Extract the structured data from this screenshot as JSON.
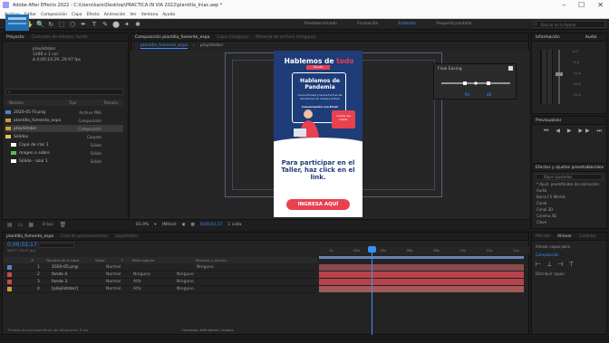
{
  "window": {
    "title": "Adobe After Effects 2022 - C:\\Users\\karo\\Desktop\\PRACTICA IN VIA 2022\\plantilla_Iniac.aep *",
    "controls": [
      "–",
      "☐",
      "✕"
    ]
  },
  "menu": [
    "Archivo",
    "Editar",
    "Composición",
    "Capa",
    "Efecto",
    "Animación",
    "Ver",
    "Ventana",
    "Ayuda"
  ],
  "toolbar": {
    "tools": [
      "⌂",
      "▶",
      "✋",
      "🔍",
      "↻",
      "⬚",
      "⬡",
      "✒",
      "T",
      "✎",
      "⬤",
      "✦",
      "✱"
    ],
    "workspaces": [
      "Predeterminado",
      "Formación",
      "Estándar",
      "Pequeña pantalla"
    ],
    "active_workspace": "Estándar",
    "search_placeholder": "Buscar en la Ayuda"
  },
  "project": {
    "tab": "Proyecto",
    "tab2": "Controles de efectos: fondo",
    "thumb_name": "playlistsbsr",
    "thumb_info1": "1280 x 1 col",
    "thumb_info2": "Δ 0;00;14;29, 29.97 fps",
    "headers": [
      "Nombre",
      "Tipo",
      "Tamaño",
      "Velocidad"
    ],
    "items": [
      {
        "name": "2020-05 Fil.png",
        "type": "Archivo PNG",
        "size": "147 KB",
        "color": "#4f83c4"
      },
      {
        "name": "plantilla_fomento_espa",
        "type": "Composición",
        "size": "",
        "color": "#c8a03a"
      },
      {
        "name": "playlistsbsr",
        "type": "Composición",
        "size": "",
        "color": "#c8a03a",
        "selected": true
      },
      {
        "name": "Sólidos",
        "type": "Carpeta",
        "size": "",
        "color": "#e3c35c"
      },
      {
        "name": "Capa de clar 1",
        "type": "Sólido",
        "size": "",
        "color": "#c64848"
      },
      {
        "name": "magen o sobre",
        "type": "Sólido",
        "size": "",
        "color": "#c64848"
      },
      {
        "name": "Sólido - azul 1",
        "type": "Sólido",
        "size": "",
        "color": "#c64848"
      }
    ],
    "bpc": "8 bpc"
  },
  "composition": {
    "tab": "Composición plantilla_fomento_espa",
    "tab2": "Capa (ninguno)",
    "tab3": "Material de archivo (ninguno)",
    "breadcrumb1": "plantilla_fomento_espa",
    "breadcrumb2": "playlistsbsr",
    "zoom": "81,9%",
    "resolution": "(Mitad)",
    "time": "0;00;02;17",
    "view": "1 vista"
  },
  "artwork": {
    "title_a": "Hablemos de",
    "title_b": "todo",
    "badge": "TALLER",
    "subtitle": "Hablemos de Pandemia",
    "desc": "Conocémosla y busca formas de blindarnos de manera activa",
    "tag": "Conversación con Ernst",
    "bubble": "Cuarta del hábito",
    "cta": "Para participar en el Taller, haz click en el link.",
    "button": "INGRESA AQUÍ"
  },
  "easy_panel": {
    "title": "Flow Easing",
    "v1": "93",
    "v2": "48"
  },
  "info": {
    "tab": "Información",
    "tab2": "Audio",
    "scale": [
      "0,0",
      "-6,0",
      "-12,0",
      "-18,0",
      "-24,0"
    ]
  },
  "preview": {
    "tab": "Previsualizar",
    "controls": "⏮ ◀ ▶ ▶▶ ⏭",
    "effects_tab": "Efectos y ajustes preestablecidos",
    "effects_search": "Bajos ajustados",
    "effects_items": [
      "* Ajust. predefinidos de animación",
      "Audio",
      "Barra FX Worlds",
      "Canal",
      "Canal 3D",
      "Cinema 4D",
      "Clave"
    ]
  },
  "timeline": {
    "tab": "plantilla_fomento_espa",
    "tab2": "Cola de procesamiento",
    "tab3": "playlistsbsr",
    "time": "0;00;02;17",
    "fps": "00077 (29,97 fps)",
    "headers": [
      "#",
      "Nombre de la capa",
      "Modo",
      "T",
      "Mate seguim.",
      "Primario y vínculo"
    ],
    "layers": [
      {
        "num": "1",
        "name": "2020-05.png",
        "mode": "Normal",
        "track": "",
        "parent": "Ninguno",
        "color": "#4f83c4"
      },
      {
        "num": "2",
        "name": "fondo 4",
        "mode": "Normal",
        "track": "Ninguno",
        "parent": "Ninguno",
        "color": "#c64848"
      },
      {
        "num": "3",
        "name": "fondo 3",
        "mode": "Normal",
        "track": "Alfa",
        "parent": "Ninguno",
        "color": "#c64848"
      },
      {
        "num": "4",
        "name": "[playlistsbsr]",
        "mode": "Normal",
        "track": "Alfa",
        "parent": "Ninguno",
        "color": "#c8a03a"
      }
    ],
    "ruler": [
      "0s",
      "02s",
      "04s",
      "06s",
      "08s",
      "10s",
      "12s",
      "14s"
    ],
    "bar_color": "#b7434b",
    "bar_color2": "#a45858",
    "frame_render": "Tiempo de procesamiento del fotograma: 0 ms",
    "toggle": "Conmutar definidores / modos"
  },
  "right_bottom": {
    "tab": "Párrafo",
    "tab2": "Alinear",
    "tab3": "Carácter",
    "label1": "Alinear capas para:",
    "label2": "Distribuir capas:",
    "value": "Composición"
  }
}
